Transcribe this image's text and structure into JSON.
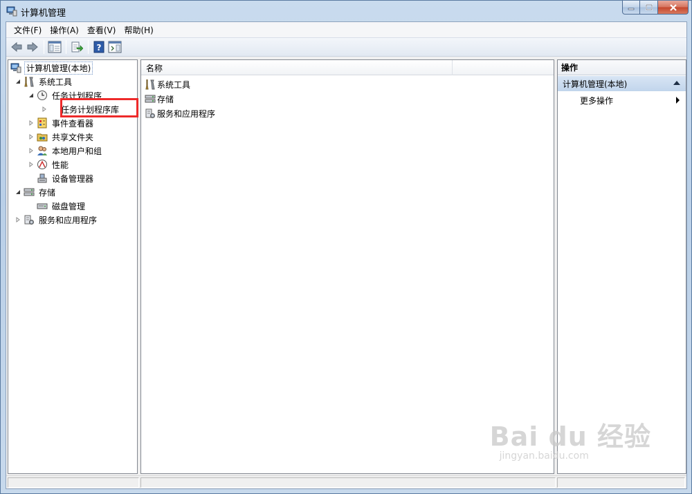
{
  "window": {
    "title": "计算机管理"
  },
  "menu": [
    {
      "label": "文件(F)"
    },
    {
      "label": "操作(A)"
    },
    {
      "label": "查看(V)"
    },
    {
      "label": "帮助(H)"
    }
  ],
  "tree": {
    "root": "计算机管理(本地)",
    "system_tools": "系统工具",
    "task_scheduler": "任务计划程序",
    "task_scheduler_library": "任务计划程序库",
    "event_viewer": "事件查看器",
    "shared_folders": "共享文件夹",
    "local_users_groups": "本地用户和组",
    "performance": "性能",
    "device_manager": "设备管理器",
    "storage": "存储",
    "disk_management": "磁盘管理",
    "services_apps": "服务和应用程序"
  },
  "list": {
    "column_name": "名称",
    "items": [
      {
        "label": "系统工具",
        "icon": "tools-icon"
      },
      {
        "label": "存储",
        "icon": "storage-icon"
      },
      {
        "label": "服务和应用程序",
        "icon": "services-icon"
      }
    ]
  },
  "actions": {
    "title": "操作",
    "group": "计算机管理(本地)",
    "more": "更多操作"
  },
  "watermark": {
    "main": "Bai du 经验",
    "sub": "jingyan.baidu.com"
  },
  "colors": {
    "highlight_box": "#ee2a2a",
    "action_group_bg": "#c9daee"
  }
}
